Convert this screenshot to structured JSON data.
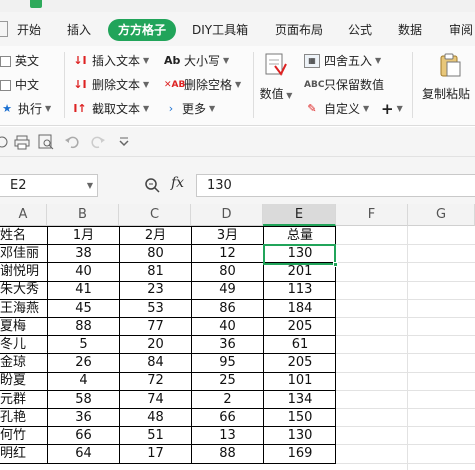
{
  "menu": {
    "tabs": [
      "开始",
      "插入",
      "方方格子",
      "DIY工具箱",
      "页面布局",
      "公式",
      "数据",
      "审阅"
    ],
    "active": "方方格子"
  },
  "ribbon": {
    "check_en": "英文",
    "check_zh": "中文",
    "execute": "执行",
    "insert_text": "插入文本",
    "delete_text": "删除文本",
    "cut_text": "截取文本",
    "case": "大小写",
    "delete_space": "删除空格",
    "more": "更多",
    "numbers": "数值",
    "round": "四舍五入",
    "keep_value": "只保留数值",
    "custom": "自定义",
    "copy_paste": "复制粘贴",
    "ab_glyph": "Ab"
  },
  "formula_bar": {
    "cell_ref": "E2",
    "fx": "fx",
    "value": "130"
  },
  "columns": [
    "A",
    "B",
    "C",
    "D",
    "E",
    "F",
    "G"
  ],
  "selected_column": "E",
  "table": {
    "headers": [
      "姓名",
      "1月",
      "2月",
      "3月",
      "总量"
    ],
    "rows": [
      [
        "邓佳丽",
        "38",
        "80",
        "12",
        "130"
      ],
      [
        "谢悦明",
        "40",
        "81",
        "80",
        "201"
      ],
      [
        "朱大秀",
        "41",
        "23",
        "49",
        "113"
      ],
      [
        "王海燕",
        "45",
        "53",
        "86",
        "184"
      ],
      [
        "夏梅",
        "88",
        "77",
        "40",
        "205"
      ],
      [
        "冬儿",
        "5",
        "20",
        "36",
        "61"
      ],
      [
        "金琼",
        "26",
        "84",
        "95",
        "205"
      ],
      [
        "盼夏",
        "4",
        "72",
        "25",
        "101"
      ],
      [
        "元群",
        "58",
        "74",
        "2",
        "134"
      ],
      [
        "孔艳",
        "36",
        "48",
        "66",
        "150"
      ],
      [
        "何竹",
        "66",
        "51",
        "13",
        "130"
      ],
      [
        "明红",
        "64",
        "17",
        "88",
        "169"
      ]
    ]
  }
}
